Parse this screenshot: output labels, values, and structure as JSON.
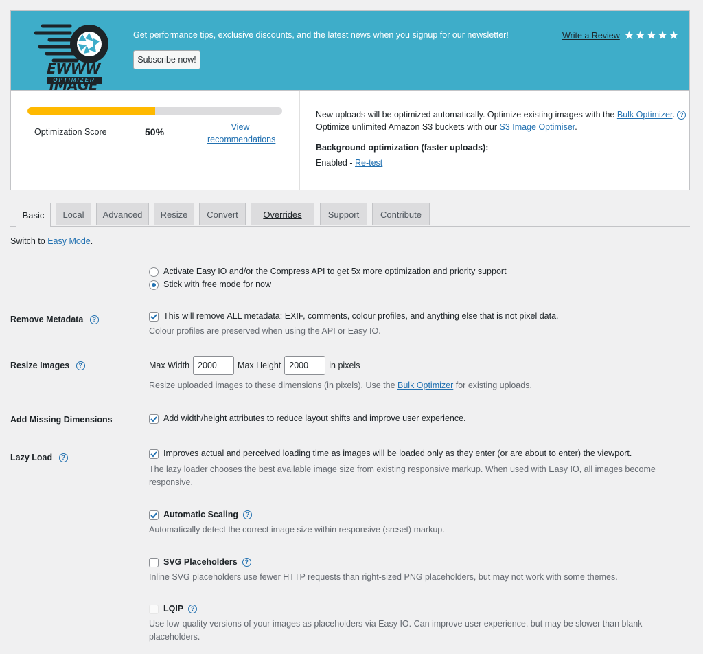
{
  "banner": {
    "logo_text": "EWWW IMAGE",
    "logo_subtext": "OPTIMIZER",
    "promo": "Get performance tips, exclusive discounts, and the latest news when you signup for our newsletter!",
    "subscribe_label": "Subscribe now!",
    "review_label": "Write a Review",
    "rating_stars": 5,
    "stars_glyphs": "★★★★★",
    "bg_color": "#3eadc9"
  },
  "status": {
    "progress": 0.5,
    "score_label": "Optimization Score",
    "score_value": "50%",
    "view_rec": "View recommendations",
    "line1_pre": "New uploads will be optimized automatically. Optimize existing images with the ",
    "bulk_link": "Bulk Optimizer",
    "line1_post": ".",
    "line2_pre": "Optimize unlimited Amazon S3 buckets with our ",
    "s3_link": "S3 Image Optimiser",
    "line2_post": ".",
    "bg_label": "Background optimization (faster uploads):",
    "bg_state": "Enabled - ",
    "retest": "Re-test"
  },
  "tabs": [
    "Basic",
    "Local",
    "Advanced",
    "Resize",
    "Convert",
    "Overrides",
    "Support",
    "Contribute"
  ],
  "switch": {
    "pre": "Switch to ",
    "link": "Easy Mode",
    "post": "."
  },
  "mode": {
    "option1": "Activate Easy IO and/or the Compress API to get 5x more optimization and priority support",
    "option2": "Stick with free mode for now",
    "selected": 2
  },
  "metadata": {
    "label": "Remove Metadata",
    "checkbox": "This will remove ALL metadata: EXIF, comments, colour profiles, and anything else that is not pixel data.",
    "desc": "Colour profiles are preserved when using the API or Easy IO.",
    "checked": true
  },
  "resize": {
    "label": "Resize Images",
    "width_label": "Max Width",
    "width_value": "2000",
    "height_label": "Max Height",
    "height_value": "2000",
    "unit": "in pixels",
    "desc_pre": "Resize uploaded images to these dimensions (in pixels). Use the ",
    "desc_link": "Bulk Optimizer",
    "desc_post": " for existing uploads."
  },
  "dimensions": {
    "label": "Add Missing Dimensions",
    "checkbox": "Add width/height attributes to reduce layout shifts and improve user experience.",
    "checked": true
  },
  "lazy": {
    "label": "Lazy Load",
    "checkbox": "Improves actual and perceived loading time as images will be loaded only as they enter (or are about to enter) the viewport.",
    "desc1": "The lazy loader chooses the best available image size from existing responsive markup. When used with Easy IO, all images become",
    "desc2": "responsive.",
    "scaling_label": "Automatic Scaling",
    "scaling_desc": "Automatically detect the correct image size within responsive (srcset) markup.",
    "svg_label": "SVG Placeholders",
    "svg_desc": "Inline SVG placeholders use fewer HTTP requests than right-sized PNG placeholders, but may not work with some themes.",
    "lqip_label": "LQIP",
    "lqip_desc1": "Use low-quality versions of your images as placeholders via Easy IO. Can improve user experience, but may be slower than blank",
    "lqip_desc2": "placeholders."
  },
  "colors": {
    "accent": "#2271b1",
    "progress": "#ffb900"
  }
}
